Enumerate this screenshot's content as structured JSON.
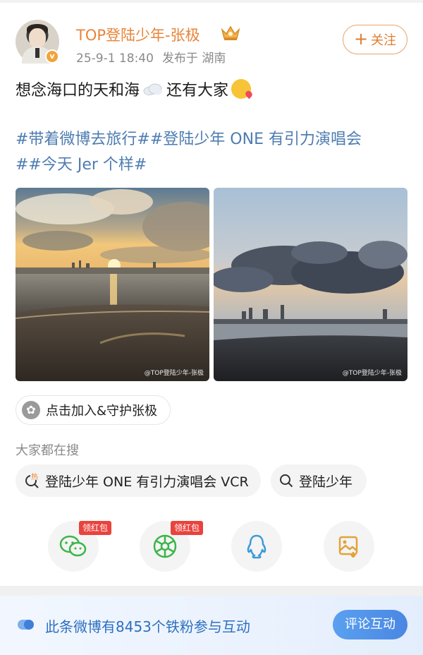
{
  "author": {
    "name": "TOP登陆少年-张极",
    "date": "25-9-1 18:40",
    "location": "发布于 湖南",
    "badge": "v"
  },
  "follow_label": "关注",
  "post": {
    "text_before": "想念海口的天和海",
    "text_after": "还有大家",
    "tags_line1": "#带着微博去旅行##登陆少年 ONE 有引力演唱会",
    "tags_line2": "##今天 Jer 个样#"
  },
  "photos": [
    {
      "watermark": "@TOP登陆少年-张极"
    },
    {
      "watermark": "@TOP登陆少年-张极"
    }
  ],
  "join_label": "点击加入&守护张极",
  "search": {
    "title": "大家都在搜",
    "chips": [
      "登陆少年 ONE 有引力演唱会 VCR",
      "登陆少年"
    ],
    "hot_mark": "热"
  },
  "share": {
    "badge": "领红包",
    "icons": [
      "wechat-icon",
      "moments-icon",
      "qq-icon",
      "save-image-icon"
    ]
  },
  "footer": {
    "fan_text": "此条微博有8453个铁粉参与互动",
    "comment_button": "评论互动"
  },
  "colors": {
    "accent": "#e8843a",
    "link": "#4d7cb0",
    "footer_text": "#2d6fc0",
    "badge_red": "#e9433e"
  }
}
